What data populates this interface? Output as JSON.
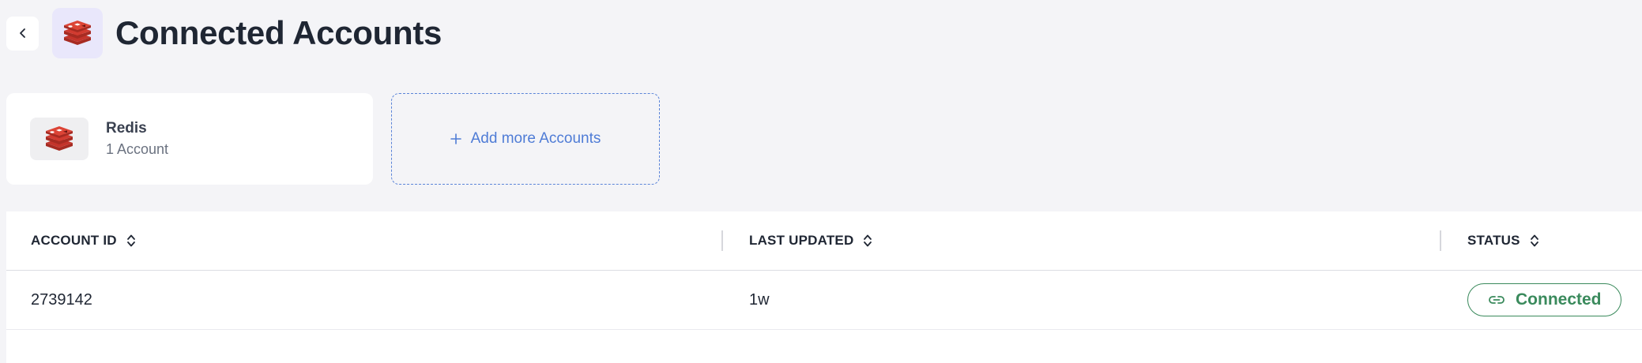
{
  "header": {
    "title": "Connected Accounts",
    "back_icon": "chevron-left-icon",
    "app_icon": "redis-logo-icon"
  },
  "colors": {
    "background": "#f4f4f7",
    "accent_blue": "#4f7cd6",
    "status_green": "#3a8a5c",
    "redis_red": "#c4342b",
    "badge_bg": "#e9e7fb"
  },
  "account_card": {
    "name": "Redis",
    "count": "1 Account",
    "icon": "redis-logo-icon"
  },
  "add_card": {
    "label": "Add more Accounts",
    "icon": "plus-icon"
  },
  "table": {
    "columns": [
      {
        "label": "ACCOUNT ID",
        "sort_icon": "sort-icon"
      },
      {
        "label": "LAST UPDATED",
        "sort_icon": "sort-icon"
      },
      {
        "label": "STATUS",
        "sort_icon": "sort-icon"
      }
    ],
    "rows": [
      {
        "account_id": "2739142",
        "last_updated": "1w",
        "status": "Connected",
        "status_icon": "link-icon"
      }
    ]
  }
}
